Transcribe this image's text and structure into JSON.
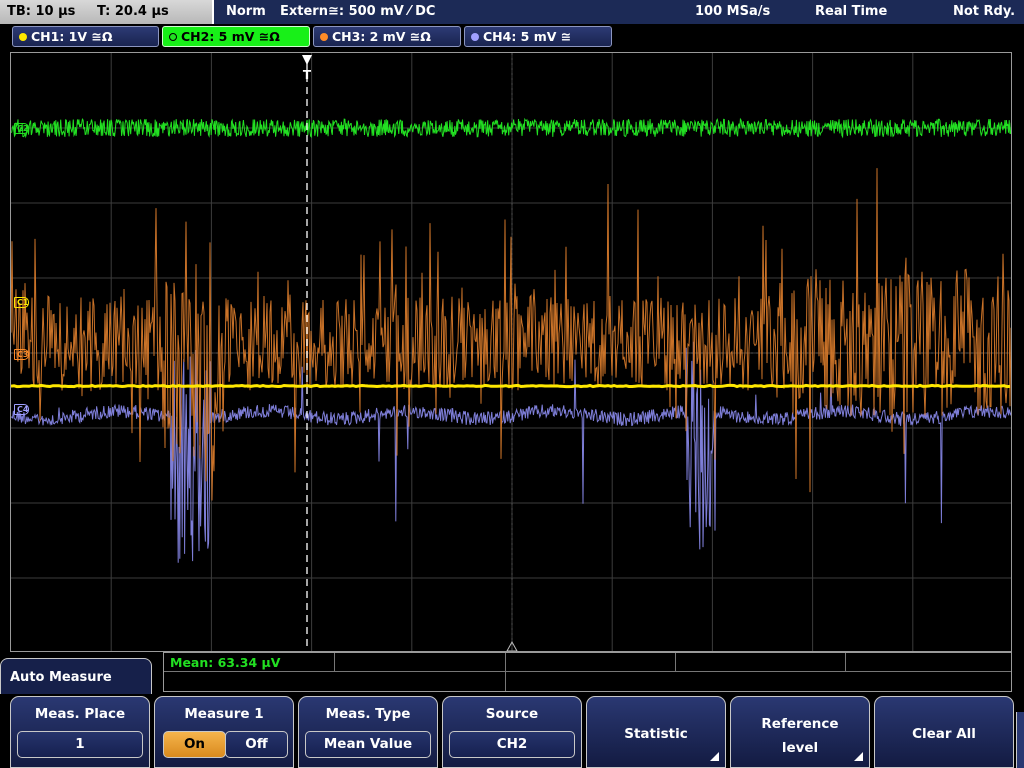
{
  "status": {
    "timebase": "TB: 10 µs",
    "trigger_time": "T: 20.4 µs",
    "mode": "Norm",
    "trigger_source": "Extern≅: 500 mV ⁄ DC",
    "sample_rate": "100 MSa/s",
    "acq_mode": "Real Time",
    "state": "Not Rdy."
  },
  "channels": [
    {
      "label": "CH1: 1V ≅Ω",
      "color": "#ffe800",
      "active": false
    },
    {
      "label": "CH2: 5 mV ≅Ω",
      "color": "#22e022",
      "active": true
    },
    {
      "label": "CH3: 2 mV ≅Ω",
      "color": "#ff8c28",
      "active": false
    },
    {
      "label": "CH4: 5 mV ≅",
      "color": "#a0a0ff",
      "active": false
    }
  ],
  "markers": {
    "c1": "C1",
    "c2": "C2",
    "c3": "C3",
    "c4": "C4",
    "trigger": "T"
  },
  "measurement": {
    "mean_text": "Mean: 63.34 µV"
  },
  "menu": {
    "title": "Auto Measure",
    "meas_place": {
      "title": "Meas. Place",
      "value": "1"
    },
    "measure1": {
      "title": "Measure 1",
      "on": "On",
      "off": "Off"
    },
    "meas_type": {
      "title": "Meas. Type",
      "value": "Mean Value"
    },
    "source": {
      "title": "Source",
      "value": "CH2"
    },
    "statistic": {
      "label": "Statistic"
    },
    "reference": {
      "line1": "Reference",
      "line2": "level"
    },
    "clear_all": {
      "label": "Clear All"
    }
  },
  "colors": {
    "ch1": "#ffe800",
    "ch2": "#22e022",
    "ch3": "#d4782a",
    "ch4": "#8c8cf0",
    "grid": "#3c3c3c",
    "menu_bg": "#1c2a56",
    "accent_on": "#f5b44c"
  }
}
